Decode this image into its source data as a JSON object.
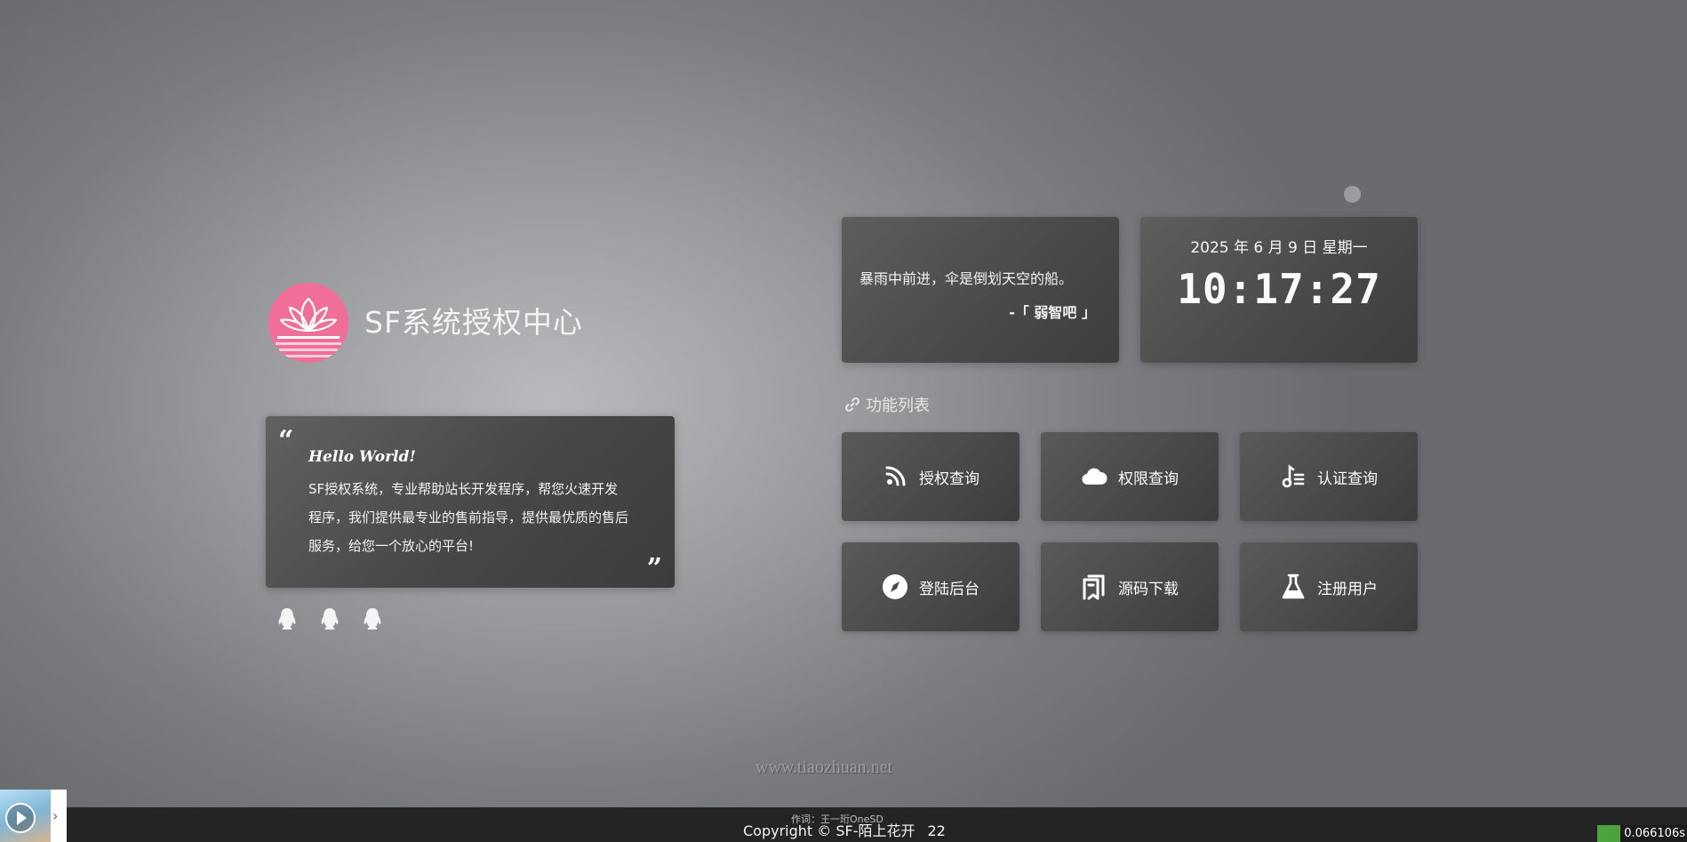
{
  "site": {
    "title": "SF系统授权中心"
  },
  "intro": {
    "heading": "Hello World!",
    "text": "SF授权系统，专业帮助站长开发程序，帮您火速开发程序，我们提供最专业的售前指导，提供最优质的售后服务，给您一个放心的平台!",
    "open_quote": "“",
    "close_quote": "”"
  },
  "contacts": [
    {
      "icon": "qq-icon"
    },
    {
      "icon": "qq-icon"
    },
    {
      "icon": "qq-icon"
    }
  ],
  "hitokoto": {
    "text": "暴雨中前进，伞是倒划天空的船。",
    "from": "-「 弱智吧 」"
  },
  "clock": {
    "date": "2025 年 6 月 9 日 星期一",
    "time": "10:17:27"
  },
  "functions": {
    "header": "功能列表",
    "items": [
      {
        "label": "授权查询",
        "icon": "rss-icon"
      },
      {
        "label": "权限查询",
        "icon": "cloud-icon"
      },
      {
        "label": "认证查询",
        "icon": "music-list-icon"
      },
      {
        "label": "登陆后台",
        "icon": "compass-icon"
      },
      {
        "label": "源码下载",
        "icon": "download-doc-icon"
      },
      {
        "label": "注册用户",
        "icon": "flask-icon"
      }
    ]
  },
  "footer": {
    "copyright": "Copyright © SF-陌上花开",
    "count": "22",
    "lyric": "作词：王一珩OneSD",
    "watermark": "www.tiaozhuan.net",
    "load_time": "0.066106s"
  },
  "colors": {
    "accent": "#ef6f98",
    "card": "#4a4a4a",
    "footer": "#242424"
  }
}
